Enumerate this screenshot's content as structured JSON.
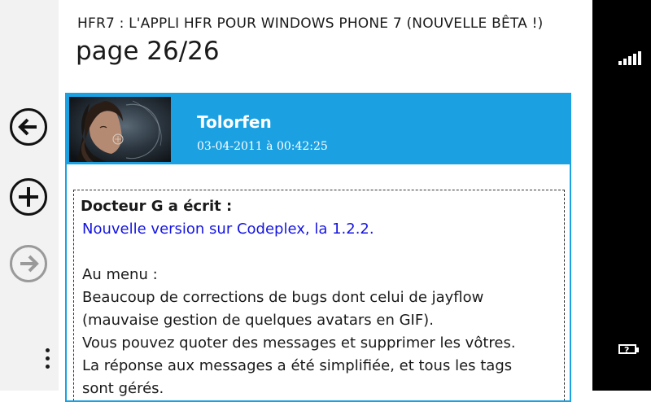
{
  "header": {
    "app_title": "HFR7 : L'APPLI HFR POUR WINDOWS PHONE 7 (NOUVELLE BÊTA !)",
    "page_title": "page 26/26"
  },
  "appbar": {
    "buttons": [
      {
        "name": "back",
        "icon": "arrow-left-circle-icon"
      },
      {
        "name": "add",
        "icon": "plus-circle-icon"
      },
      {
        "name": "forward",
        "icon": "arrow-right-circle-icon",
        "disabled": true
      }
    ],
    "menu_icon": "ellipsis-icon"
  },
  "post": {
    "author": "Tolorfen",
    "date": "03-04-2011 à 00:42:25",
    "quote_header": "Docteur G a écrit :",
    "link_text": "Nouvelle version sur Codeplex, la 1.2.2.",
    "lines": [
      "Au menu :",
      "Beaucoup de corrections de bugs dont celui de jayflow",
      "(mauvaise gestion de quelques avatars en GIF).",
      "Vous pouvez quoter des messages et supprimer les vôtres.",
      "La réponse aux messages a été simplifiée, et tous les tags",
      "sont gérés."
    ]
  },
  "colors": {
    "accent": "#1ba1e2",
    "link": "#1515e0",
    "appbar_bg": "#f2f2f2",
    "systray_bg": "#000000"
  }
}
